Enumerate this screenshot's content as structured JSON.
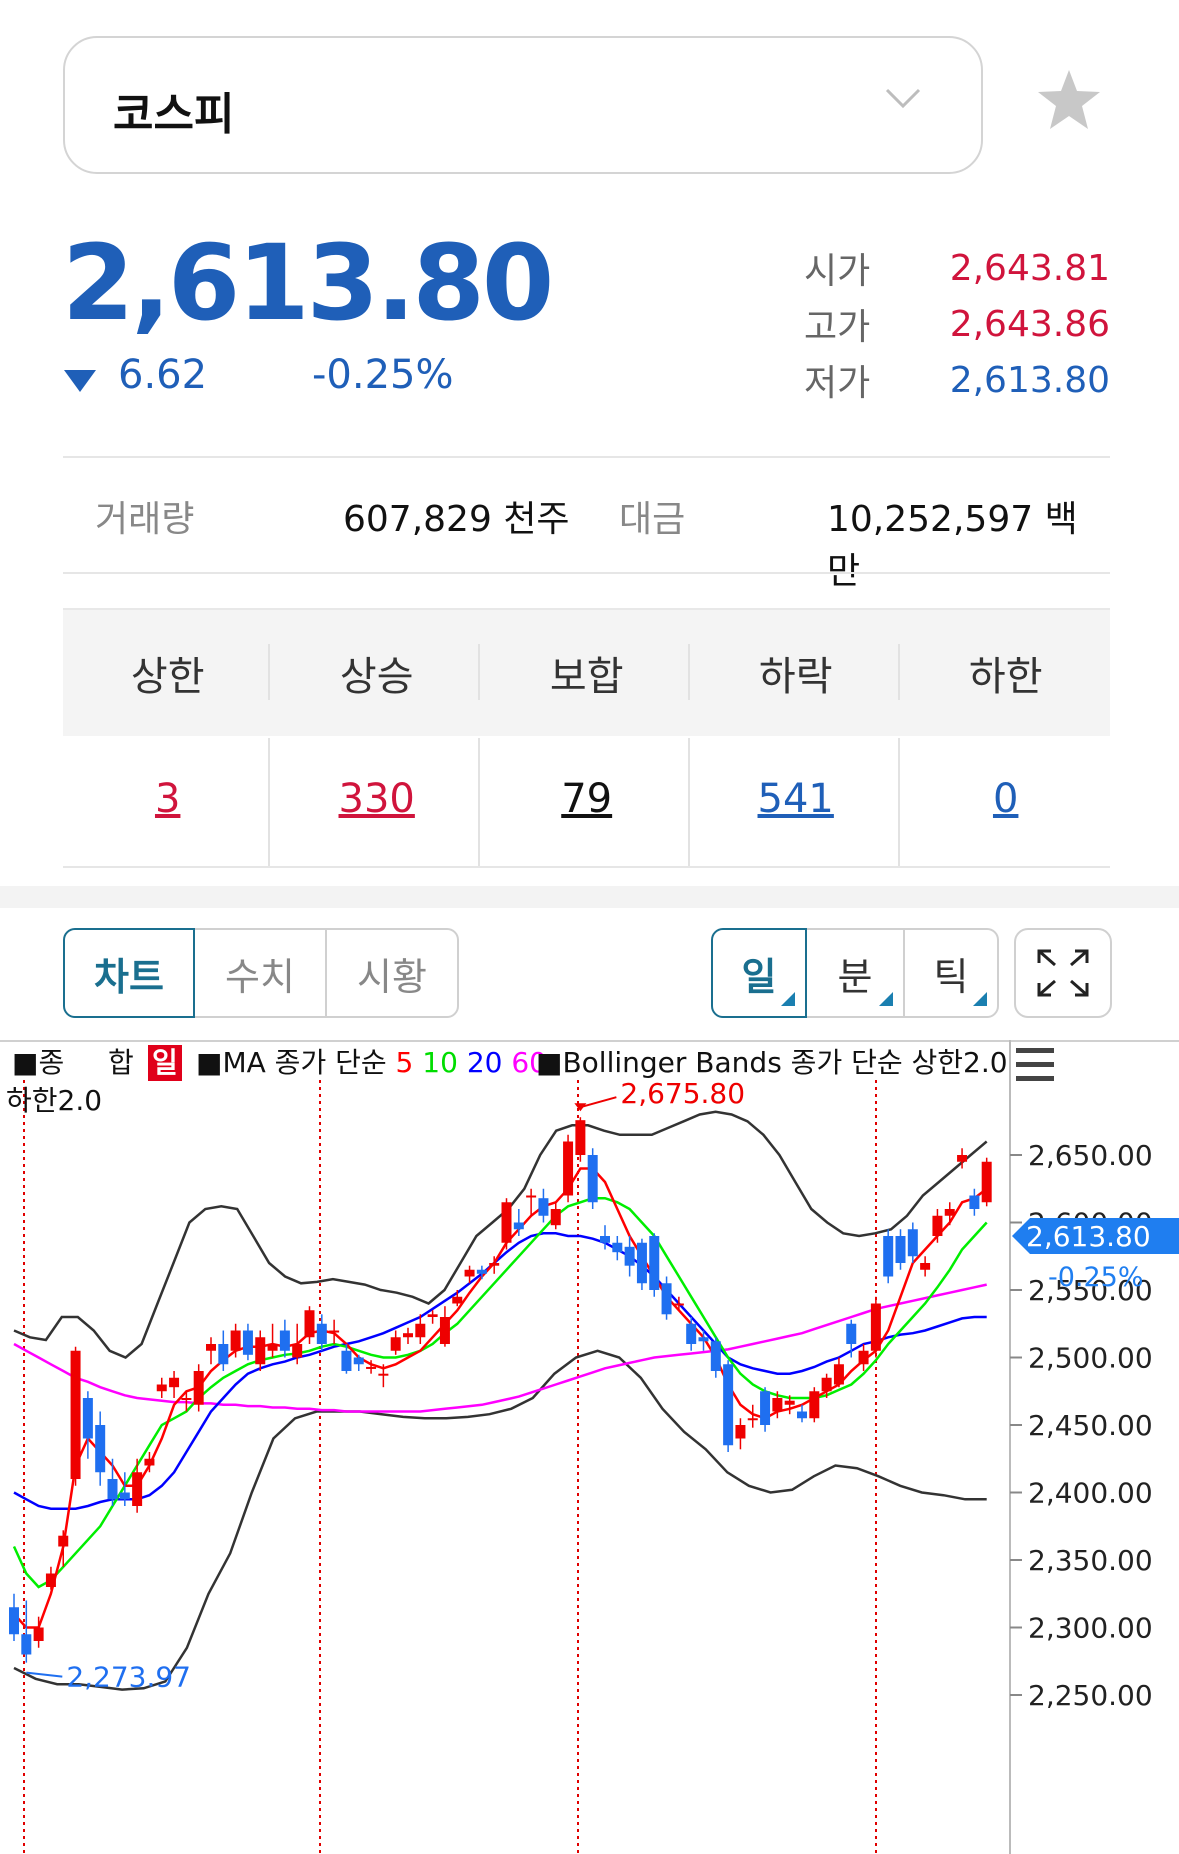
{
  "index_selector": {
    "name": "코스피"
  },
  "quote": {
    "price": "2,613.80",
    "change": "6.62",
    "change_pct": "-0.25%",
    "open_label": "시가",
    "open": "2,643.81",
    "high_label": "고가",
    "high": "2,643.86",
    "low_label": "저가",
    "low": "2,613.80"
  },
  "volume": {
    "volume_label": "거래량",
    "volume_value": "607,829 천주",
    "amount_label": "대금",
    "amount_value": "10,252,597 백만"
  },
  "breadth": {
    "headers": [
      "상한",
      "상승",
      "보합",
      "하락",
      "하한"
    ],
    "values": [
      "3",
      "330",
      "79",
      "541",
      "0"
    ]
  },
  "colors": {
    "up": "#d0143c",
    "down": "#1f5fb8",
    "accent": "#1a6f8f"
  },
  "view_tabs": [
    {
      "label": "차트",
      "active": true
    },
    {
      "label": "수치",
      "active": false
    },
    {
      "label": "시황",
      "active": false
    }
  ],
  "period_tabs": [
    {
      "label": "일",
      "active": true
    },
    {
      "label": "분",
      "active": false
    },
    {
      "label": "틱",
      "active": false
    }
  ],
  "chart_legend": {
    "marker": "■",
    "label_1": "종",
    "label_2": "합",
    "period_badge": "일",
    "ma_label": "MA 종가 단순",
    "ma_5": "5",
    "ma_10": "10",
    "ma_20": "20",
    "ma_60": "60",
    "bb_label": "Bollinger Bands 종가 단순 상한2.0",
    "bb_lower": "하한2.0"
  },
  "chart_data": {
    "type": "candlestick",
    "y_ticks": [
      "2,650.00",
      "2,600.00",
      "2,550.00",
      "2,500.00",
      "2,450.00",
      "2,400.00",
      "2,350.00",
      "2,300.00",
      "2,250.00"
    ],
    "ylim": [
      2235,
      2690
    ],
    "high_marker": "2,675.80",
    "low_marker": "2,273.97",
    "last_price": "2,613.80",
    "last_change": "-0.25%",
    "candles": [
      [
        2315,
        2295,
        2325,
        2290
      ],
      [
        2295,
        2280,
        2320,
        2273.97
      ],
      [
        2290,
        2300,
        2308,
        2285
      ],
      [
        2330,
        2340,
        2345,
        2328
      ],
      [
        2360,
        2368,
        2372,
        2345
      ],
      [
        2410,
        2505,
        2508,
        2405
      ],
      [
        2470,
        2440,
        2475,
        2425
      ],
      [
        2450,
        2415,
        2460,
        2405
      ],
      [
        2410,
        2395,
        2425,
        2390
      ],
      [
        2400,
        2395,
        2415,
        2390
      ],
      [
        2390,
        2415,
        2425,
        2385
      ],
      [
        2420,
        2425,
        2430,
        2415
      ],
      [
        2475,
        2480,
        2485,
        2470
      ],
      [
        2478,
        2485,
        2490,
        2470
      ],
      [
        2470,
        2470,
        2475,
        2460
      ],
      [
        2465,
        2490,
        2495,
        2460
      ],
      [
        2505,
        2510,
        2515,
        2495
      ],
      [
        2510,
        2495,
        2520,
        2490
      ],
      [
        2505,
        2520,
        2525,
        2500
      ],
      [
        2520,
        2502,
        2525,
        2498
      ],
      [
        2495,
        2515,
        2520,
        2490
      ],
      [
        2505,
        2510,
        2525,
        2500
      ],
      [
        2520,
        2505,
        2528,
        2500
      ],
      [
        2500,
        2510,
        2525,
        2495
      ],
      [
        2515,
        2535,
        2538,
        2510
      ],
      [
        2525,
        2510,
        2532,
        2505
      ],
      [
        2520,
        2520,
        2528,
        2510
      ],
      [
        2505,
        2490,
        2510,
        2488
      ],
      [
        2500,
        2495,
        2502,
        2490
      ],
      [
        2492,
        2493,
        2498,
        2488
      ],
      [
        2488,
        2488,
        2495,
        2478
      ],
      [
        2505,
        2515,
        2520,
        2502
      ],
      [
        2515,
        2518,
        2522,
        2510
      ],
      [
        2515,
        2525,
        2532,
        2510
      ],
      [
        2530,
        2532,
        2535,
        2525
      ],
      [
        2510,
        2530,
        2538,
        2508
      ],
      [
        2540,
        2545,
        2550,
        2538
      ],
      [
        2560,
        2565,
        2568,
        2555
      ],
      [
        2565,
        2562,
        2568,
        2558
      ],
      [
        2568,
        2570,
        2575,
        2562
      ],
      [
        2585,
        2615,
        2618,
        2580
      ],
      [
        2600,
        2595,
        2610,
        2590
      ],
      [
        2620,
        2620,
        2625,
        2605
      ],
      [
        2618,
        2605,
        2625,
        2600
      ],
      [
        2598,
        2610,
        2615,
        2595
      ],
      [
        2620,
        2660,
        2665,
        2615
      ],
      [
        2650,
        2675.8,
        2678,
        2645
      ],
      [
        2650,
        2615,
        2655,
        2610
      ],
      [
        2590,
        2585,
        2598,
        2580
      ],
      [
        2585,
        2578,
        2590,
        2572
      ],
      [
        2582,
        2568,
        2590,
        2560
      ],
      [
        2585,
        2555,
        2588,
        2550
      ],
      [
        2590,
        2550,
        2592,
        2545
      ],
      [
        2555,
        2532,
        2560,
        2528
      ],
      [
        2540,
        2540,
        2545,
        2535
      ],
      [
        2525,
        2510,
        2530,
        2505
      ],
      [
        2515,
        2512,
        2520,
        2505
      ],
      [
        2512,
        2490,
        2515,
        2485
      ],
      [
        2495,
        2435,
        2498,
        2430
      ],
      [
        2440,
        2450,
        2455,
        2432
      ],
      [
        2455,
        2455,
        2465,
        2448
      ],
      [
        2475,
        2450,
        2478,
        2445
      ],
      [
        2460,
        2470,
        2475,
        2455
      ],
      [
        2465,
        2468,
        2472,
        2458
      ],
      [
        2460,
        2455,
        2465,
        2452
      ],
      [
        2455,
        2475,
        2478,
        2452
      ],
      [
        2475,
        2485,
        2488,
        2470
      ],
      [
        2480,
        2495,
        2500,
        2478
      ],
      [
        2525,
        2510,
        2528,
        2500
      ],
      [
        2495,
        2505,
        2510,
        2490
      ],
      [
        2505,
        2540,
        2545,
        2500
      ],
      [
        2590,
        2560,
        2595,
        2555
      ],
      [
        2590,
        2570,
        2595,
        2565
      ],
      [
        2595,
        2575,
        2600,
        2570
      ],
      [
        2565,
        2570,
        2575,
        2560
      ],
      [
        2590,
        2605,
        2610,
        2585
      ],
      [
        2605,
        2610,
        2615,
        2598
      ],
      [
        2645,
        2650,
        2655,
        2640
      ],
      [
        2620,
        2610,
        2625,
        2605
      ],
      [
        2615,
        2645,
        2648,
        2612
      ]
    ],
    "ma5": [
      2310,
      2300,
      2300,
      2325,
      2360,
      2420,
      2440,
      2430,
      2420,
      2405,
      2405,
      2420,
      2440,
      2465,
      2475,
      2478,
      2490,
      2498,
      2505,
      2508,
      2508,
      2510,
      2508,
      2510,
      2518,
      2520,
      2518,
      2510,
      2500,
      2495,
      2492,
      2495,
      2500,
      2505,
      2515,
      2525,
      2535,
      2548,
      2560,
      2570,
      2585,
      2595,
      2605,
      2612,
      2615,
      2625,
      2640,
      2640,
      2630,
      2610,
      2590,
      2575,
      2560,
      2545,
      2535,
      2525,
      2515,
      2500,
      2480,
      2465,
      2458,
      2455,
      2460,
      2462,
      2465,
      2470,
      2475,
      2480,
      2490,
      2498,
      2505,
      2520,
      2545,
      2570,
      2580,
      2590,
      2600,
      2615,
      2618,
      2625
    ],
    "ma10": [
      2360,
      2340,
      2330,
      2335,
      2345,
      2355,
      2365,
      2375,
      2390,
      2405,
      2420,
      2435,
      2450,
      2455,
      2460,
      2470,
      2478,
      2485,
      2490,
      2495,
      2498,
      2500,
      2502,
      2503,
      2505,
      2508,
      2510,
      2508,
      2505,
      2502,
      2500,
      2500,
      2502,
      2505,
      2510,
      2518,
      2525,
      2535,
      2545,
      2555,
      2565,
      2575,
      2585,
      2595,
      2605,
      2612,
      2615,
      2618,
      2618,
      2615,
      2610,
      2600,
      2590,
      2575,
      2560,
      2545,
      2530,
      2515,
      2500,
      2488,
      2480,
      2475,
      2472,
      2470,
      2470,
      2470,
      2472,
      2476,
      2480,
      2488,
      2498,
      2510,
      2520,
      2530,
      2540,
      2552,
      2565,
      2580,
      2590,
      2600
    ],
    "ma20": [
      2400,
      2395,
      2390,
      2388,
      2388,
      2388,
      2390,
      2393,
      2395,
      2395,
      2395,
      2398,
      2405,
      2415,
      2430,
      2445,
      2460,
      2470,
      2480,
      2488,
      2492,
      2495,
      2497,
      2500,
      2502,
      2505,
      2508,
      2510,
      2512,
      2515,
      2518,
      2522,
      2526,
      2530,
      2536,
      2542,
      2548,
      2555,
      2562,
      2570,
      2578,
      2585,
      2590,
      2592,
      2592,
      2590,
      2590,
      2588,
      2585,
      2580,
      2575,
      2568,
      2560,
      2550,
      2540,
      2530,
      2520,
      2510,
      2500,
      2495,
      2492,
      2490,
      2488,
      2488,
      2490,
      2493,
      2497,
      2500,
      2505,
      2510,
      2512,
      2515,
      2517,
      2518,
      2520,
      2523,
      2526,
      2529,
      2530,
      2530
    ],
    "ma60": [
      2510,
      2505,
      2500,
      2495,
      2490,
      2485,
      2482,
      2478,
      2475,
      2472,
      2470,
      2469,
      2468,
      2467,
      2467,
      2466,
      2466,
      2465,
      2465,
      2464,
      2464,
      2463,
      2463,
      2462,
      2462,
      2461,
      2461,
      2460,
      2460,
      2460,
      2460,
      2460,
      2460,
      2460,
      2461,
      2462,
      2463,
      2464,
      2465,
      2467,
      2469,
      2471,
      2474,
      2477,
      2480,
      2483,
      2486,
      2489,
      2492,
      2494,
      2496,
      2498,
      2500,
      2501,
      2502,
      2503,
      2504,
      2505,
      2506,
      2508,
      2510,
      2512,
      2514,
      2516,
      2518,
      2521,
      2524,
      2527,
      2530,
      2533,
      2536,
      2538,
      2540,
      2542,
      2544,
      2546,
      2548,
      2550,
      2552,
      2554
    ],
    "bb_upper": [
      2520,
      2515,
      2513,
      2530,
      2530,
      2520,
      2505,
      2500,
      2510,
      2540,
      2570,
      2600,
      2610,
      2612,
      2610,
      2590,
      2570,
      2560,
      2555,
      2556,
      2558,
      2556,
      2554,
      2550,
      2548,
      2545,
      2540,
      2550,
      2570,
      2590,
      2600,
      2610,
      2625,
      2650,
      2668,
      2672,
      2672,
      2668,
      2665,
      2665,
      2665,
      2670,
      2675,
      2680,
      2682,
      2680,
      2675,
      2665,
      2650,
      2630,
      2610,
      2600,
      2592,
      2590,
      2592,
      2595,
      2605,
      2620,
      2630,
      2640,
      2650,
      2660
    ],
    "bb_lower": [
      2270,
      2262,
      2258,
      2258,
      2256,
      2254,
      2255,
      2260,
      2285,
      2325,
      2355,
      2400,
      2440,
      2455,
      2460,
      2460,
      2460,
      2458,
      2456,
      2455,
      2455,
      2456,
      2458,
      2462,
      2470,
      2488,
      2500,
      2505,
      2500,
      2485,
      2462,
      2445,
      2432,
      2415,
      2405,
      2400,
      2402,
      2412,
      2420,
      2418,
      2412,
      2405,
      2400,
      2398,
      2395,
      2395
    ]
  }
}
